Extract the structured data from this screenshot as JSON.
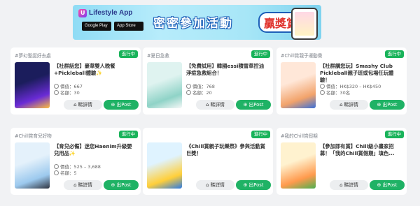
{
  "banner": {
    "app_logo_glyph": "U",
    "app_name": "Lifestyle App",
    "store_badges": [
      "Google Play",
      "App Store"
    ],
    "headline": "密密參加活動",
    "prize": "贏獎賞"
  },
  "cards": [
    {
      "tag": "#夢幻聖誕好去處",
      "status": "進行中",
      "title": "【社群話您】豪華雙人晚餐+Pickleball體驗✨",
      "meta1": "價值：667",
      "meta2": "名額：30",
      "detail_label": "睇詳情",
      "post_label": "出Post",
      "thumb_colors": [
        "#1b1d5c",
        "#6a2bd6",
        "#ffbe3d"
      ]
    },
    {
      "tag": "#夏日急救",
      "status": "進行中",
      "title": "【免費試用】韓國essi積雪草控油淨痘急救組合！",
      "meta1": "價值：768",
      "meta2": "名額：20",
      "detail_label": "睇詳情",
      "post_label": "出Post",
      "thumb_colors": [
        "#dff3f0",
        "#8fd3c7",
        "#f6f8f8"
      ]
    },
    {
      "tag": "#Chill賞親子運動樂",
      "status": "進行中",
      "title": "【社群講您玩】Smashy Club Pickleball親子班或包場任玩體驗！",
      "meta1": "價值：HK$320 – HK$450",
      "meta2": "名額：30名",
      "detail_label": "睇詳情",
      "post_label": "出Post",
      "thumb_colors": [
        "#ffe7d8",
        "#f2a36b",
        "#3a6fd8"
      ]
    },
    {
      "tag": "#Chill賞育兒好物",
      "status": "進行中",
      "title": "【育兒必備】迷您Haenim升級嬰兒用品✨",
      "meta1": "價值：525 – 3,688",
      "meta2": "名額：5",
      "detail_label": "睇詳情",
      "post_label": "出Post",
      "thumb_colors": [
        "#e4f1fb",
        "#9cc9ee",
        "#2f3440"
      ]
    },
    {
      "tag": "",
      "status": "進行中",
      "title": "《Chill賞親子玩樂祭》參與活動賞巨獎！",
      "meta1": "",
      "meta2": "",
      "detail_label": "睇詳情",
      "post_label": "出Post",
      "thumb_colors": [
        "#dff3ff",
        "#ffcf3a",
        "#2c7be5"
      ]
    },
    {
      "tag": "#我的Chill賞假期",
      "status": "進行中",
      "title": "【參加即有賞】Chill級小畫家招募！「我的Chill賞假期」填色...",
      "meta1": "",
      "meta2": "",
      "detail_label": "睇詳情",
      "post_label": "出Post",
      "thumb_colors": [
        "#fff2cf",
        "#ff9a4d",
        "#4caf50"
      ]
    }
  ],
  "icons": {
    "tag_icon": "tag-icon",
    "value_icon": "coin-icon",
    "quota_icon": "person-icon",
    "post_icon": "plus-circle-icon"
  },
  "colors": {
    "status_green": "#19b35a",
    "post_green": "#1fb265",
    "page_bg": "#f1f2f4"
  }
}
